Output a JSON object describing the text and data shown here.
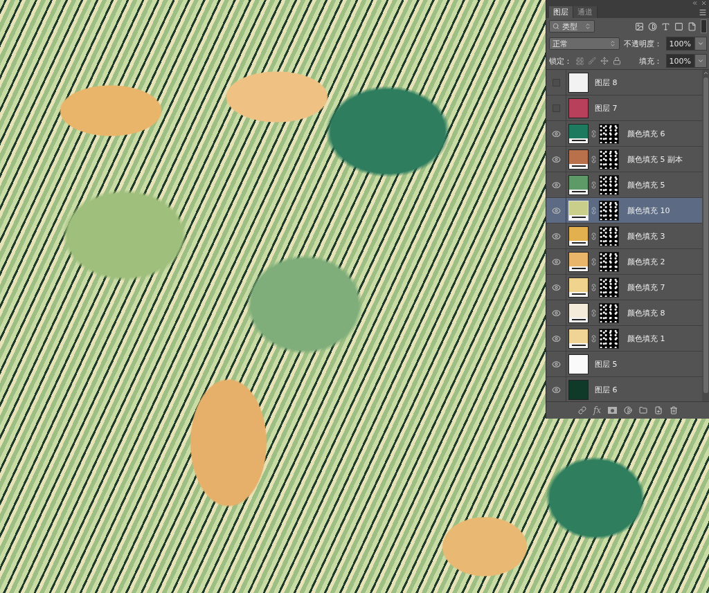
{
  "panel": {
    "tabs": [
      {
        "label": "图层",
        "selected": true
      },
      {
        "label": "通道",
        "selected": false
      }
    ],
    "filter": {
      "value": "类型"
    },
    "blend_mode": {
      "value": "正常"
    },
    "opacity": {
      "label": "不透明度：",
      "value": "100%"
    },
    "lock": {
      "label": "锁定："
    },
    "fill": {
      "label": "填充：",
      "value": "100%"
    },
    "layers": [
      {
        "name": "图层 8",
        "kind": "raster",
        "visible": false,
        "selected": false,
        "color": "#f2f2f2"
      },
      {
        "name": "图层 7",
        "kind": "raster",
        "visible": false,
        "selected": false,
        "color": "#b8405a"
      },
      {
        "name": "颜色填充 6",
        "kind": "fill",
        "visible": true,
        "selected": false,
        "color": "#1e7a5e"
      },
      {
        "name": "颜色填充 5 副本",
        "kind": "fill",
        "visible": true,
        "selected": false,
        "color": "#b8714a"
      },
      {
        "name": "颜色填充 5",
        "kind": "fill",
        "visible": true,
        "selected": false,
        "color": "#5d9a68"
      },
      {
        "name": "颜色填充 10",
        "kind": "fill",
        "visible": true,
        "selected": true,
        "color": "#c9cf8a"
      },
      {
        "name": "颜色填充 3",
        "kind": "fill",
        "visible": true,
        "selected": false,
        "color": "#e2b04e"
      },
      {
        "name": "颜色填充 2",
        "kind": "fill",
        "visible": true,
        "selected": false,
        "color": "#e9b56a"
      },
      {
        "name": "颜色填充 7",
        "kind": "fill",
        "visible": true,
        "selected": false,
        "color": "#f0d38c"
      },
      {
        "name": "颜色填充 8",
        "kind": "fill",
        "visible": true,
        "selected": false,
        "color": "#f5ebda"
      },
      {
        "name": "颜色填充 1",
        "kind": "fill",
        "visible": true,
        "selected": false,
        "color": "#f0d496"
      },
      {
        "name": "图层 5",
        "kind": "raster",
        "visible": true,
        "selected": false,
        "color": "#fafafa"
      },
      {
        "name": "图层 6",
        "kind": "raster",
        "visible": true,
        "selected": false,
        "color": "#0f3a2a"
      }
    ],
    "bottom_bar": {
      "effects_label": "fx"
    }
  }
}
